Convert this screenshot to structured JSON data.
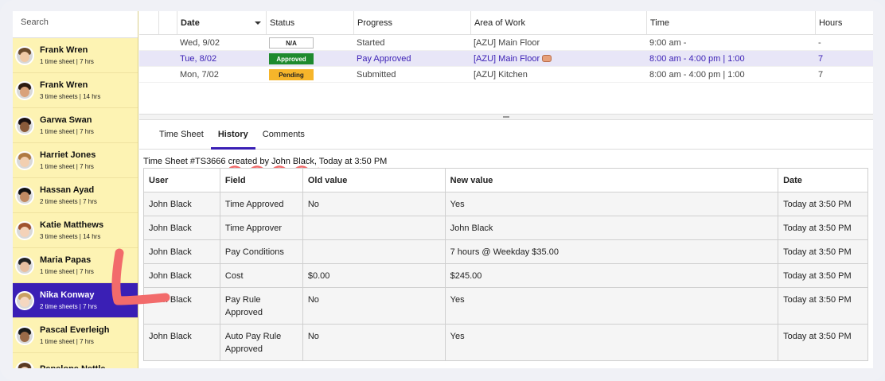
{
  "sidebar": {
    "search_placeholder": "Search",
    "employees": [
      {
        "name": "Frank Wren",
        "summary": "1 time sheet | 7 hrs",
        "active": false
      },
      {
        "name": "Frank Wren",
        "summary": "3 time sheets | 14 hrs",
        "active": false
      },
      {
        "name": "Garwa Swan",
        "summary": "1 time sheet | 7 hrs",
        "active": false
      },
      {
        "name": "Harriet Jones",
        "summary": "1 time sheet | 7 hrs",
        "active": false
      },
      {
        "name": "Hassan Ayad",
        "summary": "2 time sheets | 7 hrs",
        "active": false
      },
      {
        "name": "Katie Matthews",
        "summary": "3 time sheets | 14 hrs",
        "active": false
      },
      {
        "name": "Maria Papas",
        "summary": "1 time sheet | 7 hrs",
        "active": false
      },
      {
        "name": "Nika Konway",
        "summary": "2 time sheets | 7 hrs",
        "active": true
      },
      {
        "name": "Pascal Everleigh",
        "summary": "1 time sheet | 7 hrs",
        "active": false
      },
      {
        "name": "Penelope Nettle",
        "summary": "",
        "active": false
      }
    ]
  },
  "grid": {
    "headers": {
      "date": "Date",
      "status": "Status",
      "progress": "Progress",
      "area": "Area of Work",
      "time": "Time",
      "hours": "Hours"
    },
    "rows": [
      {
        "date": "Wed, 9/02",
        "status": "N/A",
        "status_kind": "na",
        "progress": "Started",
        "area": "[AZU] Main Floor",
        "time": "9:00 am -",
        "hours": "-"
      },
      {
        "date": "Tue, 8/02",
        "status": "Approved",
        "status_kind": "approved",
        "progress": "Pay Approved",
        "area": "[AZU] Main Floor",
        "time": "8:00 am - 4:00 pm | 1:00",
        "hours": "7"
      },
      {
        "date": "Mon, 7/02",
        "status": "Pending",
        "status_kind": "pending",
        "progress": "Submitted",
        "area": "[AZU] Kitchen",
        "time": "8:00 am - 4:00 pm | 1:00",
        "hours": "7"
      }
    ]
  },
  "tabs": {
    "timesheet": "Time Sheet",
    "history": "History",
    "comments": "Comments"
  },
  "history": {
    "caption": "Time Sheet #TS3666  created by John Black, Today at 3:50 PM",
    "headers": {
      "user": "User",
      "field": "Field",
      "old": "Old value",
      "new": "New value",
      "date": "Date"
    },
    "rows": [
      {
        "user": "John Black",
        "field": "Time Approved",
        "old": "No",
        "new": "Yes",
        "date": "Today at 3:50 PM"
      },
      {
        "user": "John Black",
        "field": "Time Approver",
        "old": "",
        "new": "John Black",
        "date": "Today at 3:50 PM"
      },
      {
        "user": "John Black",
        "field": "Pay Conditions",
        "old": "",
        "new": "7 hours @ Weekday $35.00",
        "date": "Today at 3:50 PM"
      },
      {
        "user": "John Black",
        "field": "Cost",
        "old": "$0.00",
        "new": "$245.00",
        "date": "Today at 3:50 PM"
      },
      {
        "user": "John Black",
        "field": "Pay Rule Approved",
        "old": "No",
        "new": "Yes",
        "date": "Today at 3:50 PM"
      },
      {
        "user": "John Black",
        "field": "Auto Pay Rule Approved",
        "old": "No",
        "new": "Yes",
        "date": "Today at 3:50 PM"
      }
    ]
  },
  "colors": {
    "accent": "#3a1fb5",
    "sidebar_bg": "#fdf3b3",
    "approved": "#1e8a2e",
    "pending": "#f6b52a",
    "annotation": "#f26b6b"
  }
}
